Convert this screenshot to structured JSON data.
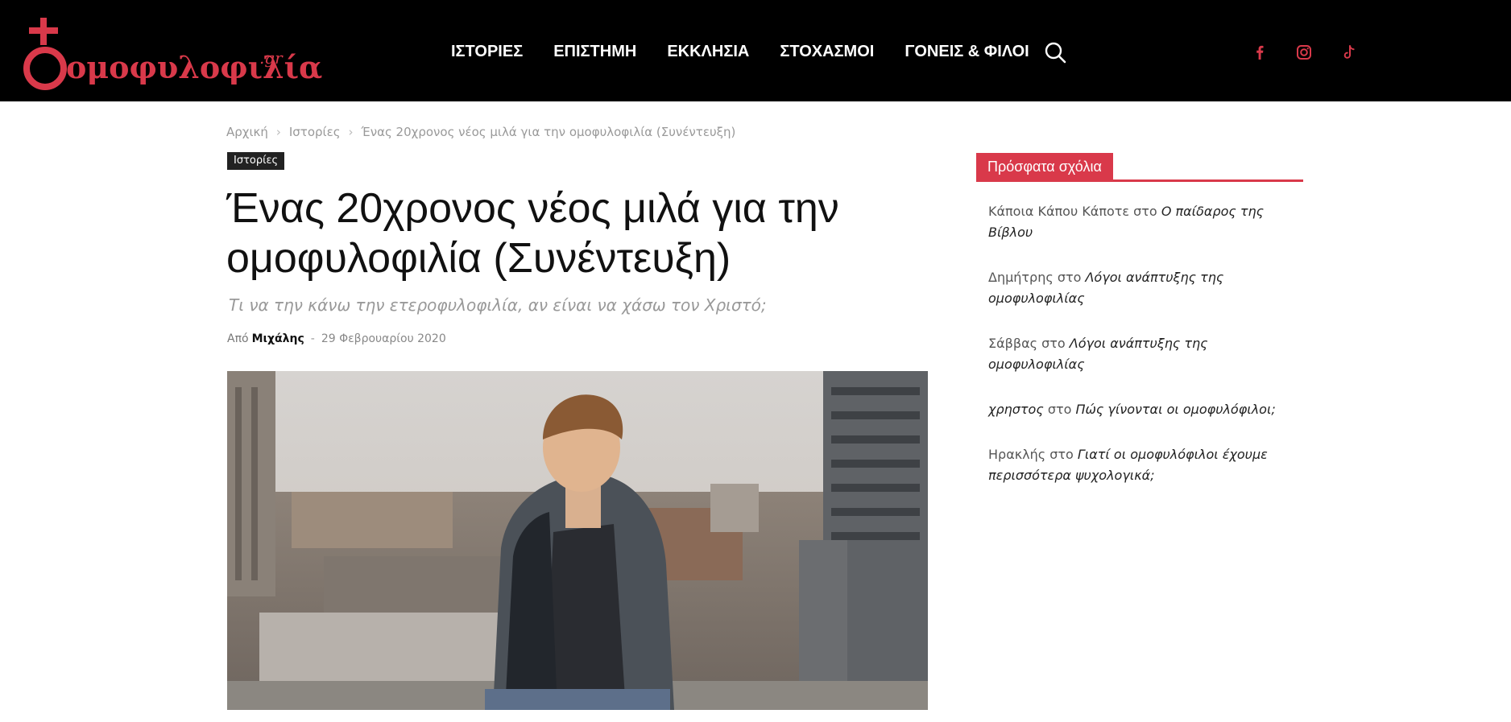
{
  "logo": {
    "text": "ομοφυλοφιλία",
    "suffix": ".gr"
  },
  "nav": {
    "items": [
      "ΙΣΤΟΡΙΕΣ",
      "ΕΠΙΣΤΗΜΗ",
      "ΕΚΚΛΗΣΙΑ",
      "ΣΤΟΧΑΣΜΟΙ",
      "ΓΟΝΕΙΣ & ΦΙΛΟΙ"
    ]
  },
  "icons": {
    "search": "search-icon",
    "social": [
      "facebook-icon",
      "instagram-icon",
      "tiktok-icon"
    ]
  },
  "colors": {
    "accent": "#d9394a",
    "header_bg": "#000000"
  },
  "breadcrumb": {
    "home": "Αρχική",
    "section": "Ιστορίες",
    "current": "Ένας 20χρονος νέος μιλά για την ομοφυλοφιλία (Συνέντευξη)",
    "separator": "›"
  },
  "article": {
    "category": "Ιστορίες",
    "title": "Ένας 20χρονος νέος μιλά για την ομοφυλοφιλία (Συνέντευξη)",
    "subtitle": "Τι να την κάνω την ετεροφυλοφιλία, αν είναι να χάσω τον Χριστό;",
    "by_label": "Από",
    "author": "Μιχάλης",
    "separator": "-",
    "date": "29 Φεβρουαρίου 2020"
  },
  "sidebar": {
    "widget_title": "Πρόσφατα σχόλια",
    "on_word": "στο",
    "comments": [
      {
        "author": "Κάποια Κάπου Κάποτε",
        "post": "Ο παίδαρος της Βίβλου"
      },
      {
        "author": "Δημήτρης",
        "post": "Λόγοι ανάπτυξης της ομοφυλοφιλίας"
      },
      {
        "author": "Σάββας",
        "post": "Λόγοι ανάπτυξης της ομοφυλοφιλίας"
      },
      {
        "author": "χρηστος",
        "post": "Πώς γίνονται οι ομοφυλόφιλοι;"
      },
      {
        "author": "Ηρακλής",
        "post": "Γιατί οι ομοφυλόφιλοι έχουμε περισσότερα ψυχολογικά;"
      }
    ]
  }
}
